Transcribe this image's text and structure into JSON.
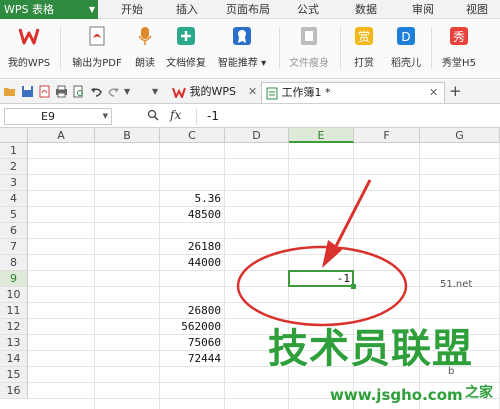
{
  "menubar": {
    "app_label": "WPS 表格",
    "tabs": [
      "开始",
      "插入",
      "页面布局",
      "公式",
      "数据",
      "审阅",
      "视图"
    ]
  },
  "ribbon": {
    "buttons": [
      {
        "label": "我的WPS",
        "icon": "wps-logo-icon"
      },
      {
        "label": "输出为PDF",
        "icon": "pdf-export-icon"
      },
      {
        "label": "朗读",
        "icon": "microphone-icon"
      },
      {
        "label": "文档修复",
        "icon": "repair-icon"
      },
      {
        "label": "智能推荐 ▾",
        "icon": "recommend-icon"
      },
      {
        "label": "文件瘦身",
        "icon": "file-slim-icon"
      },
      {
        "label": "打赏",
        "icon": "reward-icon"
      },
      {
        "label": "稻壳儿",
        "icon": "docer-icon"
      },
      {
        "label": "秀堂H5",
        "icon": "xiutang-icon"
      }
    ]
  },
  "doc_tabs": [
    {
      "label": "我的WPS",
      "active": false
    },
    {
      "label": "工作簿1 *",
      "active": true
    }
  ],
  "formula_bar": {
    "cell_ref": "E9",
    "fx": "fx",
    "content": "-1"
  },
  "sheet": {
    "columns": [
      "A",
      "B",
      "C",
      "D",
      "E",
      "F",
      "G"
    ],
    "selected_column": "E",
    "rows": [
      "1",
      "2",
      "3",
      "4",
      "5",
      "6",
      "7",
      "8",
      "9",
      "10",
      "11",
      "12",
      "13",
      "14",
      "15",
      "16"
    ],
    "selected_row": "9",
    "cells": [
      {
        "ref": "C4",
        "value": "5.36"
      },
      {
        "ref": "C5",
        "value": "48500"
      },
      {
        "ref": "C7",
        "value": "26180"
      },
      {
        "ref": "C8",
        "value": "44000"
      },
      {
        "ref": "E9",
        "value": "-1"
      },
      {
        "ref": "C11",
        "value": "26800"
      },
      {
        "ref": "C12",
        "value": "562000"
      },
      {
        "ref": "C13",
        "value": "75060"
      },
      {
        "ref": "C14",
        "value": "72444"
      }
    ]
  },
  "watermark": {
    "title": "技术员联盟",
    "url": "www.jsgho.com",
    "fragments": [
      "51.net",
      "b",
      "之家"
    ]
  },
  "colors": {
    "accent_green": "#3c9b3c",
    "annotation_red": "#d9322c",
    "watermark_green": "#2e9f3a"
  }
}
